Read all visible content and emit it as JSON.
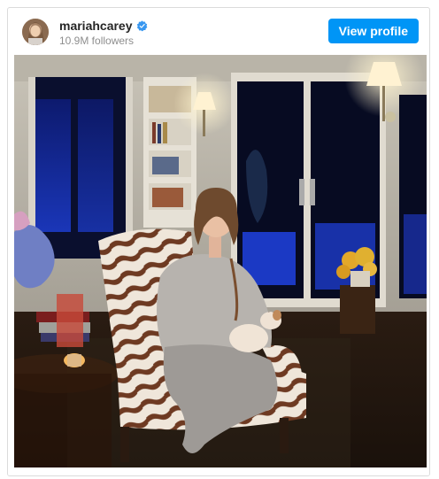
{
  "post": {
    "username": "mariahcarey",
    "followers": "10.9M followers",
    "view_profile_label": "View profile"
  },
  "colors": {
    "accent": "#0095f6",
    "verified": "#3897f0"
  },
  "icons": {
    "verified": "verified-badge-icon"
  }
}
